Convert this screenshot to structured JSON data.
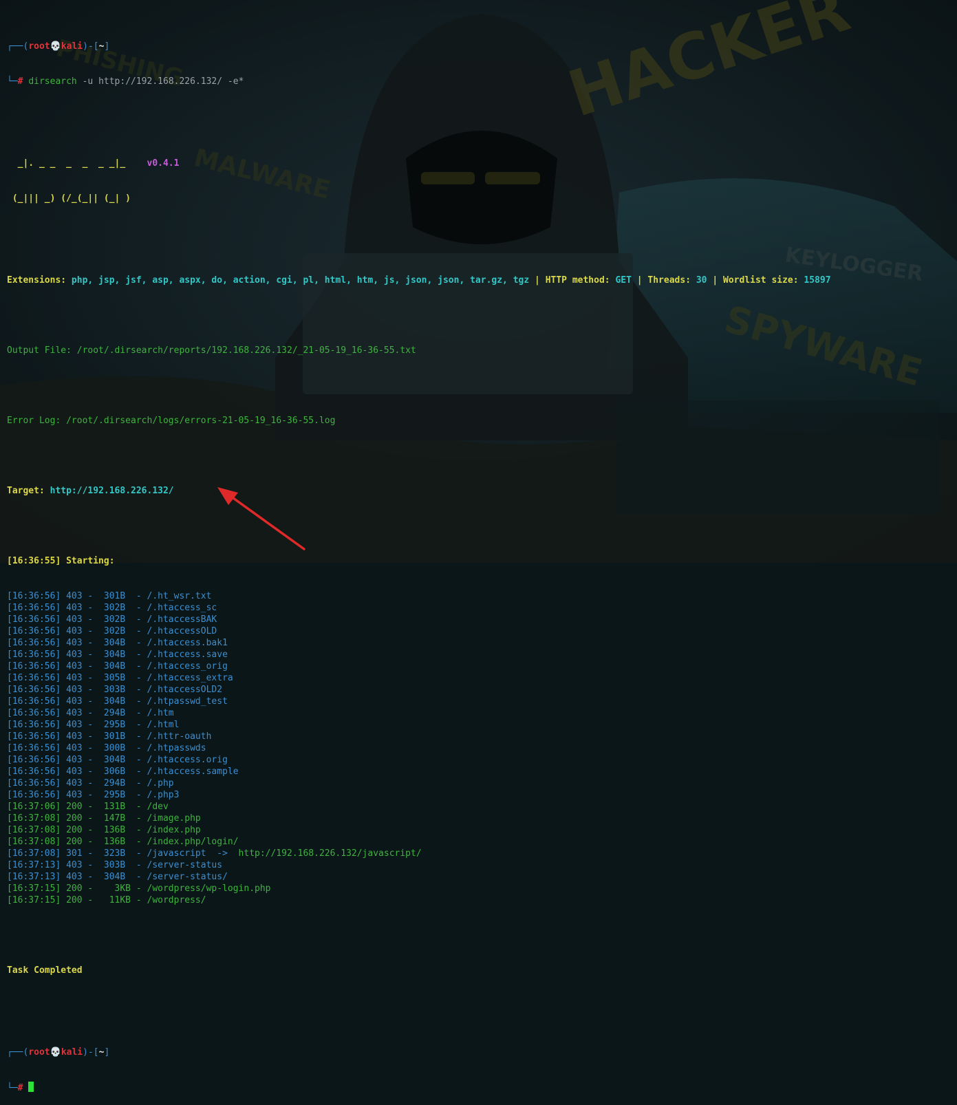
{
  "prompt1": {
    "corner_top": "┌──(",
    "user": "root",
    "skull": "💀",
    "host": "kali",
    "close_host": ")-[",
    "cwd": "~",
    "close_cwd": "]",
    "corner_bottom": "└─",
    "hash": "#",
    "cmd": "dirsearch",
    "args": " -u http://192.168.226.132/ -e*"
  },
  "banner": {
    "row1": "  _|. _ _  _  _  _ _|_    ",
    "row2": " (_||| _) (/_(_|| (_| )   ",
    "version": "v0.4.1"
  },
  "extensions": {
    "label": "Extensions: ",
    "value": "php, jsp, jsf, asp, aspx, do, action, cgi, pl, html, htm, js, json, json, tar.gz, tgz",
    "method_label": "HTTP method: ",
    "method_value": "GET",
    "threads_label": "Threads: ",
    "threads_value": "30",
    "wordlist_label": "Wordlist size: ",
    "wordlist_value": "15897",
    "pipe": " | "
  },
  "output_file": "Output File: /root/.dirsearch/reports/192.168.226.132/_21-05-19_16-36-55.txt",
  "error_log": "Error Log: /root/.dirsearch/logs/errors-21-05-19_16-36-55.log",
  "target": {
    "label": "Target: ",
    "url": "http://192.168.226.132/"
  },
  "starting": "[16:36:55] Starting:",
  "results": [
    {
      "text": "[16:36:56] 403 -  301B  - /.ht_wsr.txt",
      "status": "403"
    },
    {
      "text": "[16:36:56] 403 -  302B  - /.htaccess_sc",
      "status": "403"
    },
    {
      "text": "[16:36:56] 403 -  302B  - /.htaccessBAK",
      "status": "403"
    },
    {
      "text": "[16:36:56] 403 -  302B  - /.htaccessOLD",
      "status": "403"
    },
    {
      "text": "[16:36:56] 403 -  304B  - /.htaccess.bak1",
      "status": "403"
    },
    {
      "text": "[16:36:56] 403 -  304B  - /.htaccess.save",
      "status": "403"
    },
    {
      "text": "[16:36:56] 403 -  304B  - /.htaccess_orig",
      "status": "403"
    },
    {
      "text": "[16:36:56] 403 -  305B  - /.htaccess_extra",
      "status": "403"
    },
    {
      "text": "[16:36:56] 403 -  303B  - /.htaccessOLD2",
      "status": "403"
    },
    {
      "text": "[16:36:56] 403 -  304B  - /.htpasswd_test",
      "status": "403"
    },
    {
      "text": "[16:36:56] 403 -  294B  - /.htm",
      "status": "403"
    },
    {
      "text": "[16:36:56] 403 -  295B  - /.html",
      "status": "403"
    },
    {
      "text": "[16:36:56] 403 -  301B  - /.httr-oauth",
      "status": "403"
    },
    {
      "text": "[16:36:56] 403 -  300B  - /.htpasswds",
      "status": "403"
    },
    {
      "text": "[16:36:56] 403 -  304B  - /.htaccess.orig",
      "status": "403"
    },
    {
      "text": "[16:36:56] 403 -  306B  - /.htaccess.sample",
      "status": "403"
    },
    {
      "text": "[16:36:56] 403 -  294B  - /.php",
      "status": "403"
    },
    {
      "text": "[16:36:56] 403 -  295B  - /.php3",
      "status": "403"
    },
    {
      "text": "[16:37:06] 200 -  131B  - /dev",
      "status": "200"
    },
    {
      "text": "[16:37:08] 200 -  147B  - /image.php",
      "status": "200"
    },
    {
      "text": "[16:37:08] 200 -  136B  - /index.php",
      "status": "200"
    },
    {
      "text": "[16:37:08] 200 -  136B  - /index.php/login/",
      "status": "200"
    },
    {
      "text": "[16:37:08] 301 -  323B  - /javascript  ->  ",
      "status": "301",
      "redirect": "http://192.168.226.132/javascript/"
    },
    {
      "text": "[16:37:13] 403 -  303B  - /server-status",
      "status": "403"
    },
    {
      "text": "[16:37:13] 403 -  304B  - /server-status/",
      "status": "403"
    },
    {
      "text": "[16:37:15] 200 -    3KB - /wordpress/wp-login.php",
      "status": "200"
    },
    {
      "text": "[16:37:15] 200 -   11KB - /wordpress/",
      "status": "200"
    }
  ],
  "task_completed": "Task Completed",
  "prompt2": {
    "corner_top": "┌──(",
    "user": "root",
    "skull": "💀",
    "host": "kali",
    "close_host": ")-[",
    "cwd": "~",
    "close_cwd": "]",
    "corner_bottom": "└─",
    "hash": "#"
  },
  "colors": {
    "status_403": "#3b8fd0",
    "status_200": "#3fb33f",
    "status_301": "#3b8fd0",
    "redirect": "#3fb33f",
    "arrow": "#e02a2a"
  }
}
